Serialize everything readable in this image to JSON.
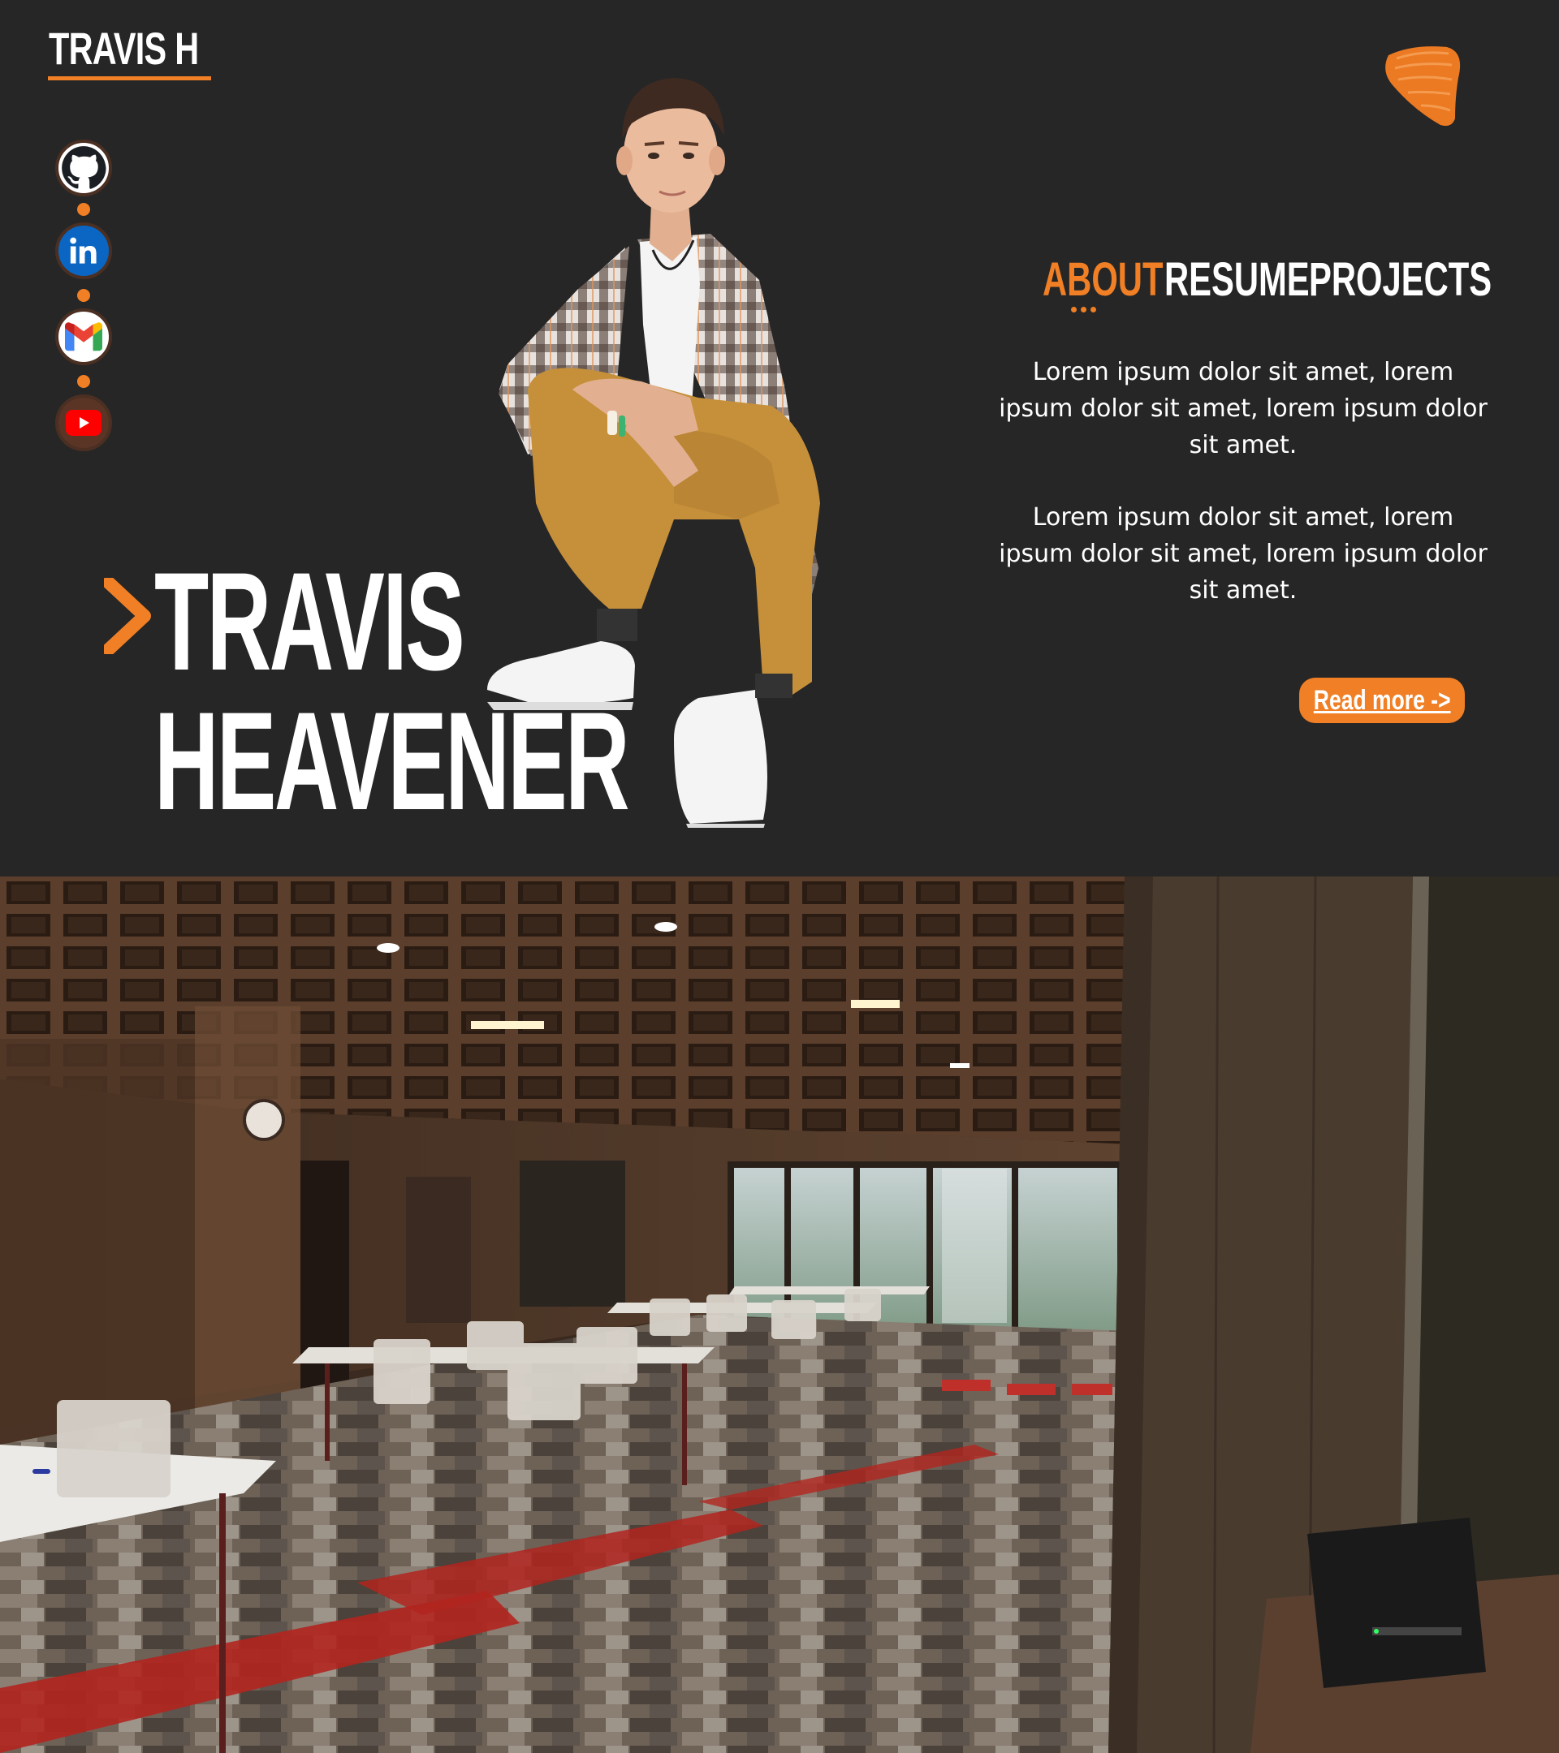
{
  "brand": {
    "logo_text": "TRAVIS H",
    "accent_color": "#f07f25",
    "background": "#262626"
  },
  "socials": [
    {
      "name": "GitHub",
      "icon": "github-icon"
    },
    {
      "name": "LinkedIn",
      "icon": "linkedin-icon"
    },
    {
      "name": "Gmail",
      "icon": "gmail-icon"
    },
    {
      "name": "YouTube",
      "icon": "youtube-icon"
    }
  ],
  "hero": {
    "first_name": "TRAVIS",
    "last_name": "HEAVENER"
  },
  "nav": {
    "items": [
      {
        "label": "ABOUT",
        "active": true
      },
      {
        "label": "RESUME",
        "active": false
      },
      {
        "label": "PROJECTS",
        "active": false
      }
    ]
  },
  "about": {
    "paragraphs": [
      "Lorem ipsum dolor sit amet, lorem ipsum dolor sit amet, lorem ipsum dolor sit amet.",
      "Lorem ipsum dolor sit amet, lorem ipsum dolor sit amet, lorem ipsum dolor sit amet."
    ],
    "read_more_label": "Read more ->"
  }
}
